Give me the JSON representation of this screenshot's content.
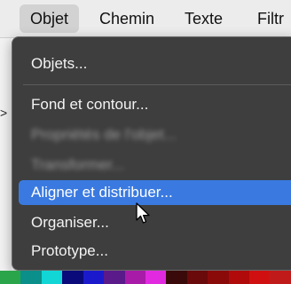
{
  "menubar": {
    "items": [
      {
        "label": "Objet",
        "active": true
      },
      {
        "label": "Chemin",
        "active": false
      },
      {
        "label": "Texte",
        "active": false
      },
      {
        "label": "Filtr",
        "active": false
      }
    ]
  },
  "side": {
    "caret": ">"
  },
  "menu": {
    "items": [
      {
        "label": "Objets...",
        "state": "normal"
      },
      {
        "label": "Fond et contour...",
        "state": "normal"
      },
      {
        "label": "Propriétés de l'objet...",
        "state": "blurred"
      },
      {
        "label": "Transformer...",
        "state": "blurred"
      },
      {
        "label": "Aligner et distribuer...",
        "state": "highlighted"
      },
      {
        "label": "Organiser...",
        "state": "normal"
      },
      {
        "label": "Prototype...",
        "state": "normal"
      }
    ]
  },
  "cursor": {
    "icon": "arrow-pointer-icon"
  },
  "palette": {
    "colors": [
      "#2aa54a",
      "#0a8f8a",
      "#12d6d6",
      "#0a0a7a",
      "#1a1acc",
      "#5a1a8a",
      "#a81aa8",
      "#e12ae0",
      "#3a0a0a",
      "#6a0a0a",
      "#8a0a0a",
      "#b00a0a",
      "#d01010",
      "#c01a1a"
    ]
  }
}
